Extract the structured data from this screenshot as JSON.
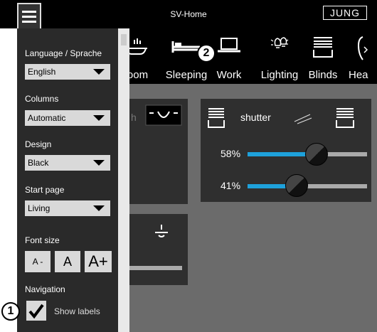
{
  "header": {
    "title": "SV-Home",
    "brand": "JUNG"
  },
  "rooms": [
    {
      "label": "room",
      "icon": "bathroom-icon"
    },
    {
      "label": "Sleeping",
      "icon": "bed-icon"
    },
    {
      "label": "Work",
      "icon": "laptop-icon"
    },
    {
      "label": "Lighting",
      "icon": "light-bulb-icon"
    },
    {
      "label": "Blinds",
      "icon": "blinds-icon"
    },
    {
      "label": "Hea",
      "icon": "heating-icon"
    }
  ],
  "settings": {
    "language": {
      "label": "Language / Sprache",
      "value": "English"
    },
    "columns": {
      "label": "Columns",
      "value": "Automatic"
    },
    "design": {
      "label": "Design",
      "value": "Black"
    },
    "start_page": {
      "label": "Start page",
      "value": "Living"
    },
    "font_size": {
      "label": "Font size",
      "small": "A -",
      "medium": "A",
      "large": "A+"
    },
    "navigation": {
      "label": "Navigation",
      "show_labels": "Show labels",
      "show_labels_checked": true
    }
  },
  "tiles": {
    "partial_text": "h",
    "shutter": {
      "name": "shutter",
      "sliders": [
        {
          "percent_label": "58%",
          "value": 0.58
        },
        {
          "percent_label": "41%",
          "value": 0.41
        }
      ]
    }
  },
  "callouts": {
    "one": "1",
    "two": "2"
  },
  "colors": {
    "accent": "#1ea1db",
    "drawer": "#2a2a2a",
    "content_bg": "#6b6b6b",
    "tile": "#2f2f2f"
  }
}
